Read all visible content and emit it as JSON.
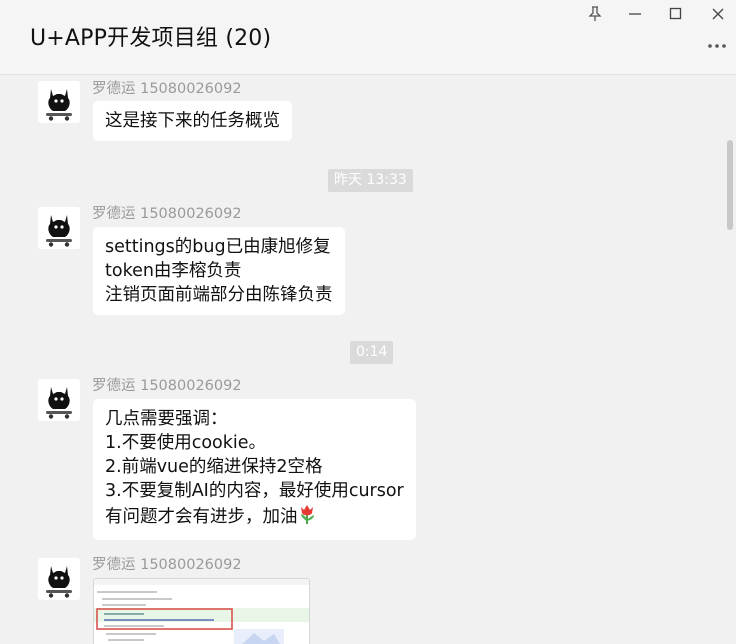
{
  "window": {
    "title": "U+APP开发项目组 (20)",
    "controls": [
      "pin-icon",
      "minimize-icon",
      "maximize-icon",
      "close-icon"
    ],
    "more_icon": "more-dots-icon"
  },
  "messages": [
    {
      "sender": "罗德运 15080026092",
      "avatar_icon": "black-cat-skateboard-avatar",
      "lines": [
        "这是接下来的任务概览"
      ]
    },
    {
      "timestamp": "昨天 13:33"
    },
    {
      "sender": "罗德运 15080026092",
      "avatar_icon": "black-cat-skateboard-avatar",
      "lines": [
        "settings的bug已由康旭修复",
        "token由李榕负责",
        "注销页面前端部分由陈锋负责"
      ]
    },
    {
      "timestamp": "0:14"
    },
    {
      "sender": "罗德运 15080026092",
      "avatar_icon": "black-cat-skateboard-avatar",
      "lines": [
        "几点需要强调：",
        "1.不要使用cookie。",
        "2.前端vue的缩进保持2空格",
        "3.不要复制AI的内容，最好使用cursor",
        "有问题才会有进步，加油"
      ],
      "emoji": "tulip-icon"
    },
    {
      "sender": "罗德运 15080026092",
      "avatar_icon": "black-cat-skateboard-avatar",
      "image": "code-screenshot-thumbnail"
    }
  ],
  "colors": {
    "background": "#f1f1f1",
    "bubble": "#ffffff",
    "sender_text": "#9a9a9a",
    "timestamp_bg": "#dadada",
    "highlight_red": "#d9534f"
  }
}
